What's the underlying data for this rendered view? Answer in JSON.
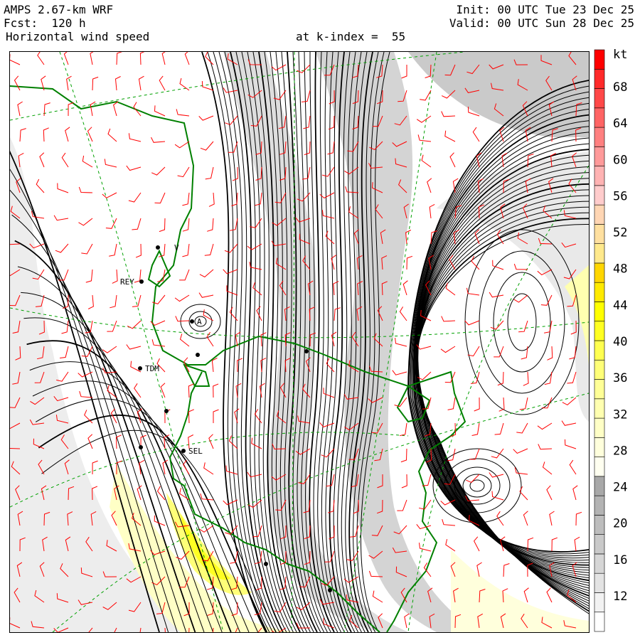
{
  "header": {
    "model": "AMPS 2.67-km WRF",
    "forecast": "Fcst:  120 h",
    "field": "Horizontal wind speed",
    "level": "at k-index =  55",
    "init": "Init: 00 UTC Tue 23 Dec 25",
    "valid": "Valid: 00 UTC Sun 28 Dec 25"
  },
  "colorbar": {
    "unit": "kt",
    "levels": [
      8,
      10,
      12,
      14,
      16,
      18,
      20,
      22,
      24,
      26,
      28,
      30,
      32,
      34,
      36,
      38,
      40,
      42,
      44,
      46,
      48,
      50,
      52,
      54,
      56,
      58,
      60,
      62,
      64,
      66,
      68,
      70
    ],
    "tick_labels": [
      "12",
      "16",
      "20",
      "24",
      "28",
      "32",
      "36",
      "40",
      "44",
      "48",
      "52",
      "56",
      "60",
      "64",
      "68"
    ],
    "colors": [
      "#ffffff",
      "#f2f2f2",
      "#e3e3e3",
      "#d6d6d6",
      "#c9c9c9",
      "#bdbdbd",
      "#b3b3b3",
      "#a8a8a8",
      "#fffff0",
      "#ffffdc",
      "#ffffc6",
      "#ffffb0",
      "#ffff96",
      "#ffff78",
      "#ffff50",
      "#ffff22",
      "#ffff00",
      "#ffea00",
      "#ffd600",
      "#ffe98c",
      "#ffe0a0",
      "#ffd6b4",
      "#ffcccc",
      "#ffb3b3",
      "#ff9a9a",
      "#ff8080",
      "#ff6464",
      "#ff4848",
      "#ff2a2a",
      "#ff0000"
    ]
  },
  "stations": [
    {
      "label": "REY",
      "kind": "labelled"
    },
    {
      "label": "TDM",
      "kind": "labelled"
    },
    {
      "label": "SEL",
      "kind": "labelled"
    },
    {
      "label": "V",
      "kind": "labelled"
    },
    {
      "label": "A",
      "kind": "labelled"
    }
  ],
  "map_colors": {
    "coastline": "#008000",
    "contour": "#000000",
    "barb": "#ff0000",
    "graticule": "#00a000"
  }
}
